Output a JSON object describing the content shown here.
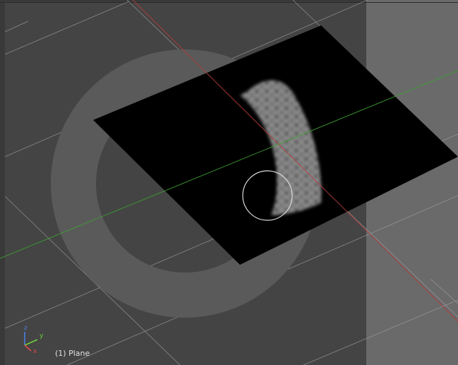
{
  "viewport": {
    "object_info": "(1) Plane",
    "axes": {
      "x": "x",
      "y": "y",
      "z": "z"
    },
    "colors": {
      "background": "#393939",
      "camera_region": "#444444",
      "right_panel": "#6a6a6a",
      "plane": "#000000",
      "grid_line": "#a0a0a0",
      "x_axis": "#b43c3c",
      "y_axis": "#3ca032",
      "z_axis": "#4a7fe0",
      "brush_circle": "#dcdcdc",
      "texture_guide": "#5a5a5a"
    }
  }
}
